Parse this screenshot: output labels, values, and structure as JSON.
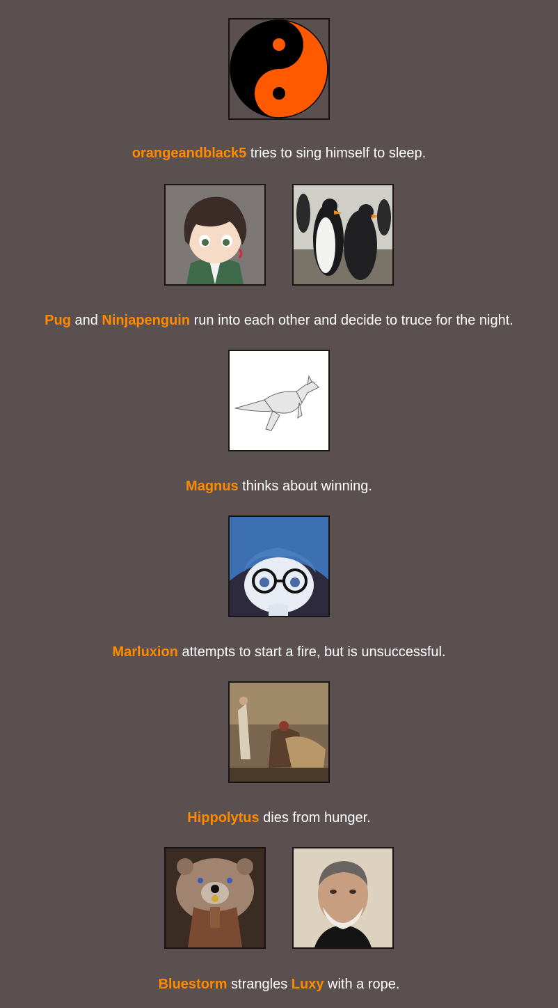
{
  "colors": {
    "background": "#5b5050",
    "name": "#ff8a00",
    "text": "#ffffff"
  },
  "events": [
    {
      "avatars": [
        "yin-yang-icon"
      ],
      "parts": [
        {
          "name": "orangeandblack5"
        },
        {
          "text": " tries to sing himself to sleep."
        }
      ]
    },
    {
      "avatars": [
        "anime-boy-avatar",
        "penguins-avatar"
      ],
      "parts": [
        {
          "name": "Pug"
        },
        {
          "text": " and "
        },
        {
          "name": "Ninjapenguin"
        },
        {
          "text": " run into each other and decide to truce for the night."
        }
      ]
    },
    {
      "avatars": [
        "kangaroo-avatar"
      ],
      "parts": [
        {
          "name": "Magnus"
        },
        {
          "text": " thinks about winning."
        }
      ]
    },
    {
      "avatars": [
        "glasses-boy-avatar"
      ],
      "parts": [
        {
          "name": "Marluxion"
        },
        {
          "text": " attempts to start a fire, but is unsuccessful."
        }
      ]
    },
    {
      "avatars": [
        "painting-avatar"
      ],
      "parts": [
        {
          "name": "Hippolytus"
        },
        {
          "text": " dies from hunger."
        }
      ]
    },
    {
      "avatars": [
        "bear-warrior-avatar",
        "bearded-man-avatar"
      ],
      "parts": [
        {
          "name": "Bluestorm"
        },
        {
          "text": " strangles "
        },
        {
          "name": "Luxy"
        },
        {
          "text": " with a rope."
        }
      ]
    }
  ]
}
